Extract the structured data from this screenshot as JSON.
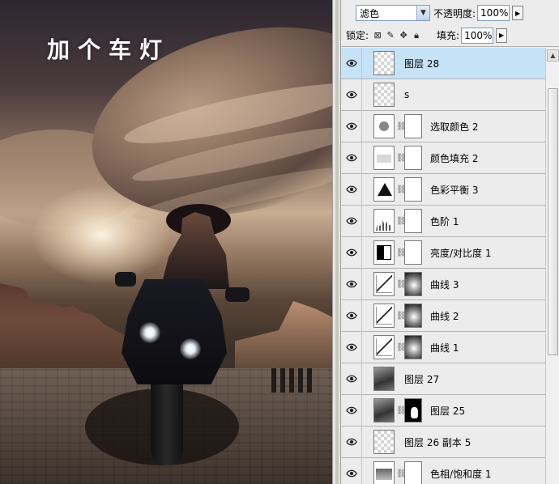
{
  "canvas": {
    "title_text": "加个车灯"
  },
  "layers_panel": {
    "blend_mode": "滤色",
    "opacity_label": "不透明度:",
    "opacity_value": "100%",
    "lock_label": "锁定:",
    "fill_label": "填充:",
    "fill_value": "100%",
    "layers": [
      {
        "name": "图层 28",
        "kind": "pixel",
        "selected": true
      },
      {
        "name": "s",
        "kind": "pixel"
      },
      {
        "name": "选取颜色 2",
        "kind": "adjustment",
        "icon": "selective-color-icon"
      },
      {
        "name": "颜色填充 2",
        "kind": "adjustment",
        "icon": "color-fill-icon"
      },
      {
        "name": "色彩平衡 3",
        "kind": "adjustment",
        "icon": "color-balance-icon"
      },
      {
        "name": "色阶 1",
        "kind": "adjustment",
        "icon": "levels-icon"
      },
      {
        "name": "亮度/对比度 1",
        "kind": "adjustment",
        "icon": "brightness-contrast-icon"
      },
      {
        "name": "曲线 3",
        "kind": "adjustment",
        "icon": "curves-icon"
      },
      {
        "name": "曲线 2",
        "kind": "adjustment",
        "icon": "curves-icon"
      },
      {
        "name": "曲线 1",
        "kind": "adjustment",
        "icon": "curves-icon"
      },
      {
        "name": "图层 27",
        "kind": "photo"
      },
      {
        "name": "图层 25",
        "kind": "photo-masked"
      },
      {
        "name": "图层 26 副本 5",
        "kind": "pixel"
      },
      {
        "name": "色相/饱和度 1",
        "kind": "adjustment",
        "icon": "hue-saturation-icon"
      }
    ]
  }
}
